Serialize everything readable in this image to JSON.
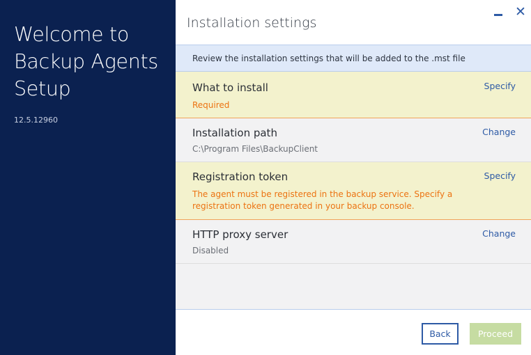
{
  "sidebar": {
    "welcome_text": "Welcome to Backup Agents Setup",
    "version": "12.5.12960"
  },
  "header": {
    "title": "Installation settings",
    "minimize_icon": "minimize-icon",
    "close_icon": "close-icon",
    "close_glyph": "✕"
  },
  "banner": {
    "text": "Review the installation settings that will be added to the .mst file"
  },
  "settings": [
    {
      "title": "What to install",
      "subtitle": "Required",
      "action": "Specify",
      "state": "warning"
    },
    {
      "title": "Installation path",
      "subtitle": "C:\\Program Files\\BackupClient",
      "action": "Change",
      "state": "normal"
    },
    {
      "title": "Registration token",
      "subtitle": "The agent must be registered in the backup service. Specify a registration token generated in your backup console.",
      "action": "Specify",
      "state": "warning"
    },
    {
      "title": "HTTP proxy server",
      "subtitle": "Disabled",
      "action": "Change",
      "state": "normal"
    }
  ],
  "footer": {
    "back_label": "Back",
    "proceed_label": "Proceed"
  },
  "colors": {
    "sidebar_bg": "#0b2150",
    "accent": "#2d5aa5",
    "warning_bg": "#f3f2cd",
    "warning_text": "#ec7312",
    "proceed_disabled": "#c6dca2"
  }
}
